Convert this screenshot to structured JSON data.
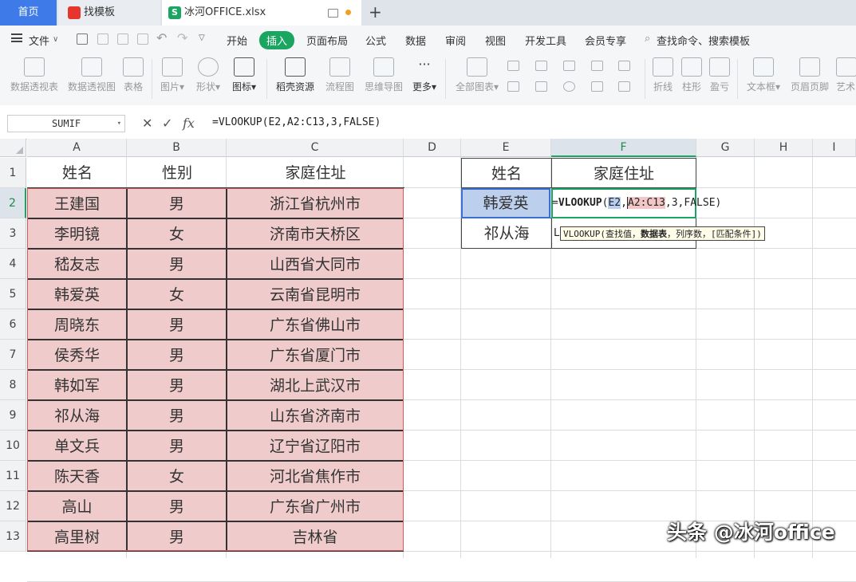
{
  "tabs": {
    "home": "首页",
    "template": "找模板",
    "file": "冰河OFFICE.xlsx",
    "file_icon": "S"
  },
  "menu": {
    "file": "文件",
    "items": [
      "开始",
      "插入",
      "页面布局",
      "公式",
      "数据",
      "审阅",
      "视图",
      "开发工具",
      "会员专享"
    ],
    "active": "插入",
    "search": "查找命令、搜索模板"
  },
  "ribbon": {
    "pivot_table": "数据透视表",
    "pivot_chart": "数据透视图",
    "table": "表格",
    "picture": "图片",
    "shape": "形状",
    "icon": "图标",
    "docer": "稻壳资源",
    "flowchart": "流程图",
    "mindmap": "思维导图",
    "more": "更多",
    "all_charts": "全部图表",
    "line": "折线",
    "column": "柱形",
    "winloss": "盈亏",
    "textbox": "文本框",
    "header_footer": "页眉页脚",
    "art": "艺术"
  },
  "formula_bar": {
    "name_box": "SUMIF",
    "formula": "=VLOOKUP(E2,A2:C13,3,FALSE)"
  },
  "columns": [
    "A",
    "B",
    "C",
    "D",
    "E",
    "F",
    "G",
    "H",
    "I"
  ],
  "rows": [
    "1",
    "2",
    "3",
    "4",
    "5",
    "6",
    "7",
    "8",
    "9",
    "10",
    "11",
    "12",
    "13"
  ],
  "table": {
    "headers": [
      "姓名",
      "性别",
      "家庭住址"
    ],
    "data": [
      [
        "王建国",
        "男",
        "浙江省杭州市"
      ],
      [
        "李明镜",
        "女",
        "济南市天桥区"
      ],
      [
        "嵇友志",
        "男",
        "山西省大同市"
      ],
      [
        "韩爱英",
        "女",
        "云南省昆明市"
      ],
      [
        "周晓东",
        "男",
        "广东省佛山市"
      ],
      [
        "侯秀华",
        "男",
        "广东省厦门市"
      ],
      [
        "韩如军",
        "男",
        "湖北上武汉市"
      ],
      [
        "祁从海",
        "男",
        "山东省济南市"
      ],
      [
        "单文兵",
        "男",
        "辽宁省辽阳市"
      ],
      [
        "陈天香",
        "女",
        "河北省焦作市"
      ],
      [
        "高山",
        "男",
        "广东省广州市"
      ],
      [
        "高里树",
        "男",
        "吉林省"
      ]
    ]
  },
  "lookup": {
    "headers": [
      "姓名",
      "家庭住址"
    ],
    "e2": "韩爱英",
    "e3": "祁从海",
    "f2_prefix": "=",
    "f2_func": "VLOOKUP",
    "f2_open": "(",
    "f2_ref1": "E2",
    "f2_comma": ",",
    "f2_ref2": "A2:C13",
    "f2_rest": ",3,FALSE)",
    "f3_partial": "L",
    "tooltip_func": "VLOOKUP",
    "tooltip_a": "(查找值，",
    "tooltip_b": "数据表",
    "tooltip_c": "，列序数，[匹配条件])"
  },
  "watermark": "头条 @冰河office",
  "colors": {
    "accent": "#1aa661",
    "home_tab": "#3e7be8",
    "table_fill": "#efcbcb",
    "e2_fill": "#bcd0ee"
  }
}
